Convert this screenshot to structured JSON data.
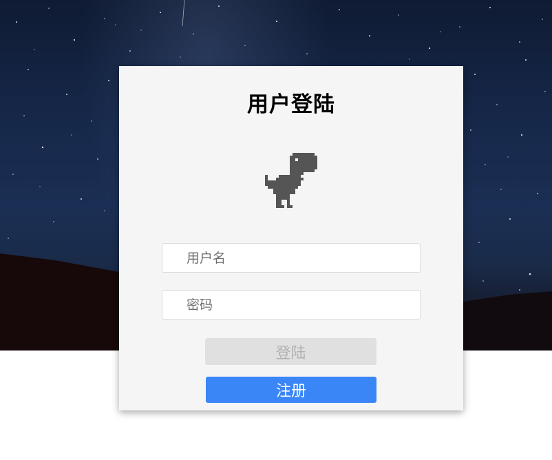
{
  "login_card": {
    "title": "用户登陆",
    "username_placeholder": "用户名",
    "password_placeholder": "密码",
    "login_button": "登陆",
    "register_button": "注册"
  },
  "colors": {
    "register_button": "#3a86f7",
    "login_button_disabled": "#e0e0e0",
    "card_background": "#f5f5f5",
    "dino": "#555555"
  },
  "icons": {
    "mascot": "dinosaur-icon"
  }
}
